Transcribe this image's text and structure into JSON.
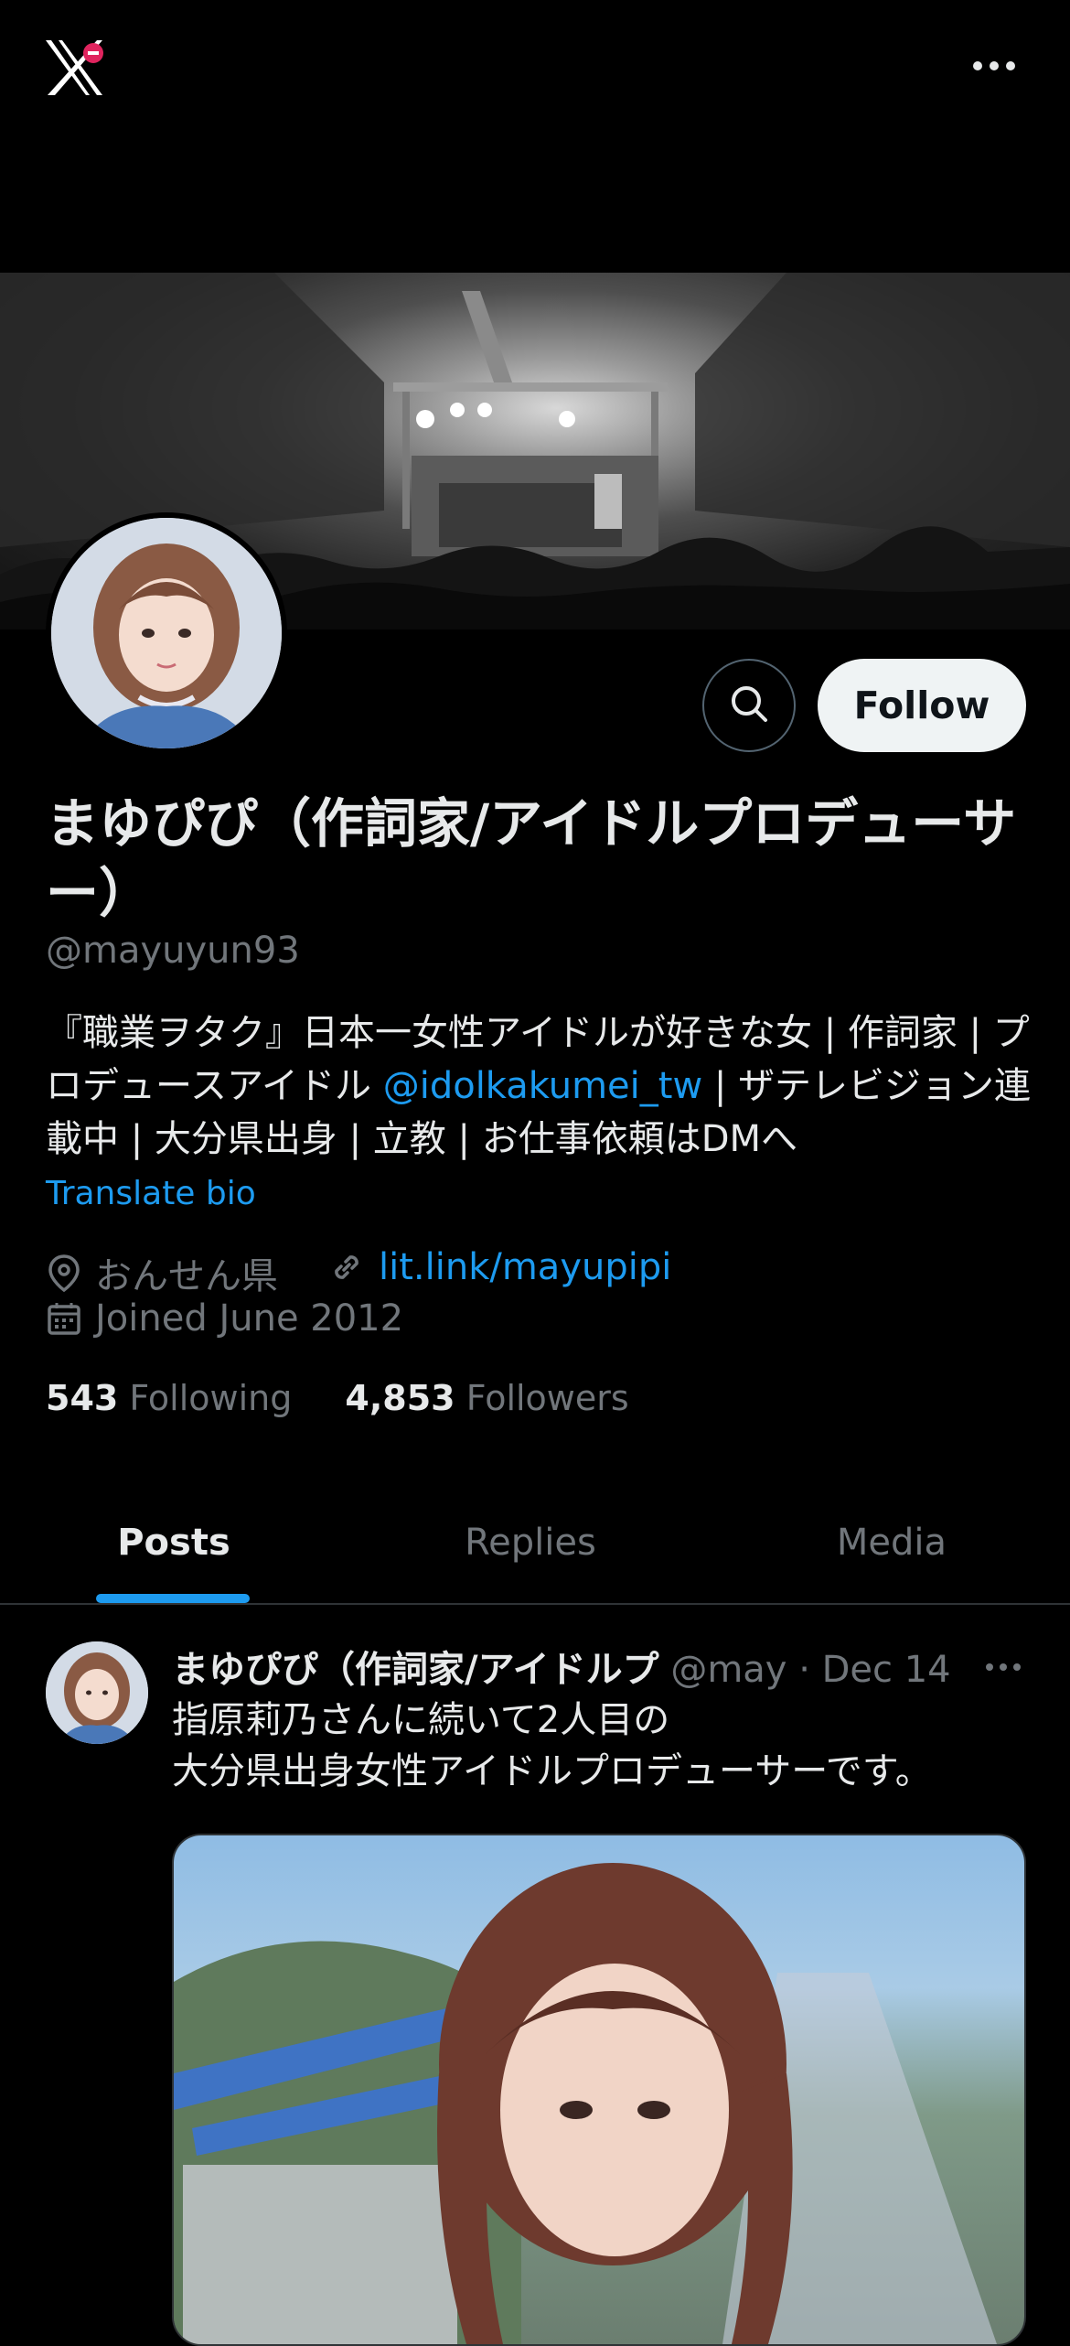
{
  "colors": {
    "background": "#000000",
    "primary_text": "#e7e9ea",
    "secondary_text": "#71767b",
    "accent": "#1d9bf0",
    "follow_button_bg": "#eff3f4"
  },
  "top_bar": {
    "logo_icon": "x-logo-icon",
    "more_icon": "more-horizontal-icon"
  },
  "profile": {
    "display_name": "まゆぴぴ（作詞家/アイドルプロデューサー）",
    "handle": "@mayuyun93",
    "bio_part1": "『職業ヲタク』日本一女性アイドルが好きな女 | 作詞家 | プロデュースアイドル ",
    "bio_mention": "@idolkakumei_tw",
    "bio_part2": " | ザテレビジョン連載中 | 大分県出身 | 立教 | お仕事依頼はDMへ",
    "translate_label": "Translate bio",
    "location": "おんせん県",
    "website": "lit.link/mayupipi",
    "joined": "Joined June 2012",
    "following_count": "543",
    "following_label": "Following",
    "followers_count": "4,853",
    "followers_label": "Followers"
  },
  "actions": {
    "search_icon": "search-icon",
    "follow_label": "Follow"
  },
  "tabs": [
    {
      "label": "Posts",
      "active": true
    },
    {
      "label": "Replies",
      "active": false
    },
    {
      "label": "Media",
      "active": false
    }
  ],
  "post": {
    "author": "まゆぴぴ（作詞家/アイドルプ",
    "handle_date": " @may · Dec 14",
    "line1": "指原莉乃さんに続いて2人目の",
    "line2": "大分県出身女性アイドルプロデューサーです。"
  }
}
